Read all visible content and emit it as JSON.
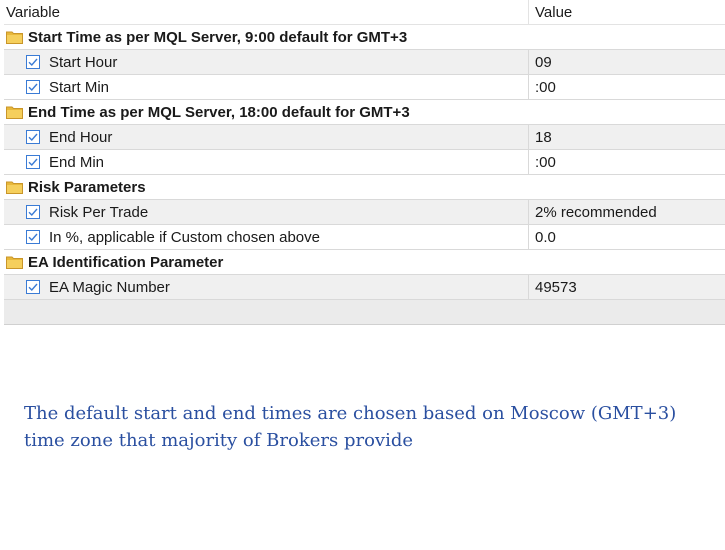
{
  "header": {
    "variable": "Variable",
    "value": "Value"
  },
  "groups": [
    {
      "title": "Start Time as per MQL Server, 9:00 default for GMT+3",
      "items": [
        {
          "name": "Start Hour",
          "value": "09"
        },
        {
          "name": "Start Min",
          "value": ":00"
        }
      ]
    },
    {
      "title": "End Time as per MQL Server, 18:00 default for GMT+3",
      "items": [
        {
          "name": "End Hour",
          "value": "18"
        },
        {
          "name": "End Min",
          "value": ":00"
        }
      ]
    },
    {
      "title": "Risk Parameters",
      "items": [
        {
          "name": "Risk Per Trade",
          "value": "2% recommended"
        },
        {
          "name": "In %, applicable if Custom chosen above",
          "value": "0.0"
        }
      ]
    },
    {
      "title": "EA Identification Parameter",
      "items": [
        {
          "name": "EA Magic Number",
          "value": "49573"
        }
      ]
    }
  ],
  "icons": {
    "group": "folder-icon",
    "item": "checkbox-checked-icon"
  },
  "colors": {
    "folder": "#e8b83a",
    "check": "#3a7bd5",
    "note": "#2a4fa0",
    "shaded_row": "#f0f0f0"
  },
  "note": "The default start and end times are chosen based on Moscow (GMT+3) time zone that majority of Brokers provide"
}
